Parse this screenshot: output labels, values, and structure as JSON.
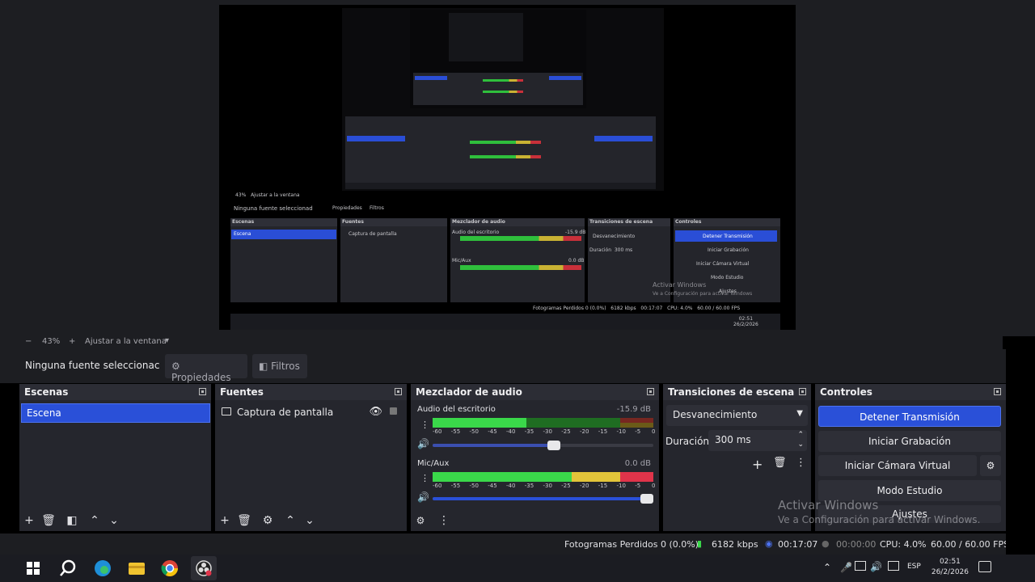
{
  "zoom_bar": {
    "minus": "−",
    "zoom": "43%",
    "plus": "+",
    "fit": "Ajustar a la ventana"
  },
  "context_bar": {
    "no_source": "Ninguna fuente seleccionac",
    "properties": "Propiedades",
    "filters": "Filtros"
  },
  "scenes": {
    "title": "Escenas",
    "items": [
      "Escena"
    ]
  },
  "sources": {
    "title": "Fuentes",
    "items": [
      "Captura de pantalla"
    ]
  },
  "mixer": {
    "title": "Mezclador de audio",
    "channels": [
      {
        "name": "Audio del escritorio",
        "db": "-15.9 dB",
        "volume": 0.55
      },
      {
        "name": "Mic/Aux",
        "db": "0.0 dB",
        "volume": 0.98
      }
    ],
    "scale": [
      "-60",
      "-55",
      "-50",
      "-45",
      "-40",
      "-35",
      "-30",
      "-25",
      "-20",
      "-15",
      "-10",
      "-5",
      "0"
    ]
  },
  "transitions": {
    "title": "Transiciones de escena",
    "selected": "Desvanecimiento",
    "duration_label": "Duración",
    "duration_value": "300 ms"
  },
  "controls": {
    "title": "Controles",
    "stop_stream": "Detener Transmisión",
    "start_recording": "Iniciar Grabación",
    "start_virtual_cam": "Iniciar Cámara Virtual",
    "studio_mode": "Modo Estudio",
    "settings": "Ajustes"
  },
  "status": {
    "dropped": "Fotogramas Perdidos 0 (0.0%)",
    "bitrate": "6182 kbps",
    "stream_time": "00:17:07",
    "rec_time": "00:00:00",
    "cpu": "CPU: 4.0%",
    "fps": "60.00 / 60.00 FPS"
  },
  "watermark": {
    "title": "Activar Windows",
    "subtitle": "Ve a Configuración para activar Windows."
  },
  "taskbar": {
    "lang": "ESP",
    "time": "02:51",
    "date": "26/2/2026"
  },
  "preview": {
    "nested_scene": "Escena",
    "nested_source": "Captura de pantalla",
    "nested_no_source": "Ninguna fuente seleccionad",
    "nested_stop": "Detener Transmisión",
    "nested_rec": "Iniciar Grabación",
    "nested_vcam": "Iniciar Cámara Virtual",
    "nested_studio": "Modo Estudio",
    "nested_settings": "Ajustes",
    "nested_status": "Fotogramas Perdidos 0 (0.0%)",
    "nested_kbps": "6182 kbps",
    "nested_time": "00:17:07",
    "nested_cpu": "CPU: 4.0%",
    "nested_fps": "60.00 / 60.00 FPS",
    "nested_watermark": "Activar Windows",
    "nested_watermark_sub": "Ve a Configuración para activar Windows",
    "nested_zoom": "43%",
    "nested_fit": "Ajustar a la ventana",
    "nested_scenes_title": "Escenas",
    "nested_sources_title": "Fuentes",
    "nested_mixer_title": "Mezclador de audio",
    "nested_trans_title": "Transiciones de escena",
    "nested_ctrl_title": "Controles",
    "nested_desktop": "Audio del escritorio",
    "nested_mic": "Mic/Aux",
    "nested_db1": "-15.9 dB",
    "nested_db2": "0.0 dB",
    "nested_trans": "Desvanecimiento",
    "nested_dur": "Duración",
    "nested_ms": "300 ms",
    "nested_props": "Propiedades",
    "nested_filters": "Filtros",
    "nested_clock": "02:51",
    "nested_date": "26/2/2026"
  }
}
